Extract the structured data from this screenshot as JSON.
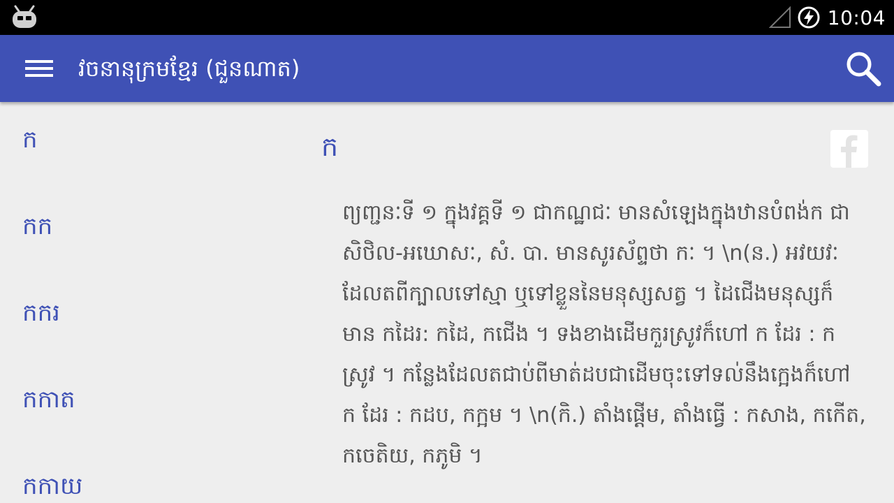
{
  "status_bar": {
    "logo_icon": "cyanogen-bugdroid-icon",
    "signal_icon": "no-signal-icon",
    "battery_icon": "battery-charging-icon",
    "time": "10:04"
  },
  "app_bar": {
    "title": "វចនានុក្រមខ្មែរ (ជួនណាត)",
    "menu_icon": "hamburger-menu-icon",
    "search_icon": "search-icon",
    "color": "#3f51b5"
  },
  "word_list": [
    {
      "label": "ក"
    },
    {
      "label": "កក"
    },
    {
      "label": "កករ"
    },
    {
      "label": "កកាត"
    },
    {
      "label": "កកាយ"
    }
  ],
  "detail": {
    "headword": "ក",
    "share_icon": "facebook-icon",
    "definition": "ព្យញ្ជនៈទី ១ ក្នុងវគ្គទី ១ ជាកណ្ឋជៈ មានសំឡេងក្នុងឋានបំពង់ក ជាសិថិល-អឃោសៈ, សំ. បា. មានសូរស័ព្ទថា កៈ ។ \\n(ន.) អវយវៈដែលតពីក្បាលទៅស្មា ឬទៅខ្លួននៃមនុស្សសត្វ ។ ដៃជើងមនុស្សក៏មាន កដៃរ: កដៃ, កជើង ។ ទងខាងដើមកួរស្រូវក៏ហៅ ក ដែរ : កស្រូវ ។ កន្លែងដែលតជាប់ពីមាត់ដបជាដើមចុះទៅទល់នឹងក្អេងក៏ហៅ ក ដែរ : កដប, កក្អម ។ \\n(កិ.) តាំងផ្ដើម, តាំងធ្វើ : កសាង, កកើត, កចេតិយ, កភូមិ ។"
  }
}
